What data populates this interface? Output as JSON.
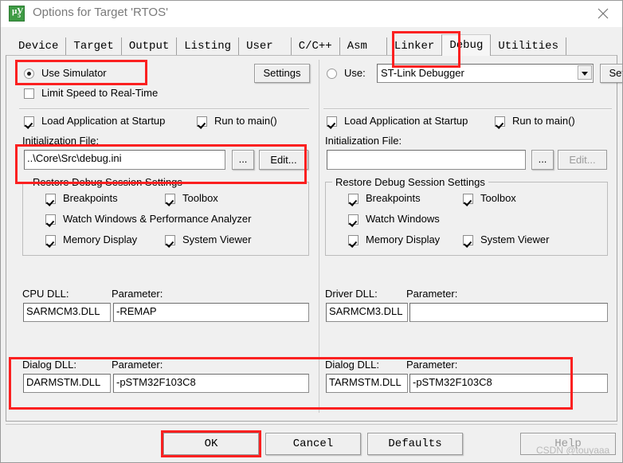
{
  "window": {
    "title": "Options for Target 'RTOS'",
    "icon": "keil-uvision-icon",
    "icon_glyph_top": "µV",
    "icon_glyph_bottom": "5",
    "close_icon": "close-icon"
  },
  "tabs": [
    {
      "label": "Device",
      "active": false
    },
    {
      "label": "Target",
      "active": false
    },
    {
      "label": "Output",
      "active": false
    },
    {
      "label": "Listing",
      "active": false
    },
    {
      "label": "User",
      "active": false
    },
    {
      "label": "C/C++",
      "active": false
    },
    {
      "label": "Asm",
      "active": false
    },
    {
      "label": "Linker",
      "active": false
    },
    {
      "label": "Debug",
      "active": true
    },
    {
      "label": "Utilities",
      "active": false
    }
  ],
  "left": {
    "use_simulator_label": "Use Simulator",
    "use_simulator_checked": true,
    "settings_button": "Settings",
    "limit_speed_label": "Limit Speed to Real-Time",
    "limit_speed_checked": false,
    "load_app_label": "Load Application at Startup",
    "load_app_checked": true,
    "run_to_main_label": "Run to main()",
    "run_to_main_checked": true,
    "init_file_label": "Initialization File:",
    "init_file_value": "..\\Core\\Src\\debug.ini",
    "browse_button": "...",
    "edit_button": "Edit...",
    "restore_group_title": "Restore Debug Session Settings",
    "restore_items": [
      {
        "label": "Breakpoints",
        "checked": true
      },
      {
        "label": "Toolbox",
        "checked": true
      },
      {
        "label": "Watch Windows & Performance Analyzer",
        "checked": true
      },
      {
        "label": "Memory Display",
        "checked": true
      },
      {
        "label": "System Viewer",
        "checked": true
      }
    ],
    "cpu_dll_label": "CPU DLL:",
    "cpu_dll_value": "SARMCM3.DLL",
    "cpu_param_label": "Parameter:",
    "cpu_param_value": "-REMAP",
    "dialog_dll_label": "Dialog DLL:",
    "dialog_dll_value": "DARMSTM.DLL",
    "dialog_param_label": "Parameter:",
    "dialog_param_value": "-pSTM32F103C8"
  },
  "right": {
    "use_label": "Use:",
    "use_checked": false,
    "debugger_selected": "ST-Link Debugger",
    "settings_button": "Settings",
    "load_app_label": "Load Application at Startup",
    "load_app_checked": true,
    "run_to_main_label": "Run to main()",
    "run_to_main_checked": true,
    "init_file_label": "Initialization File:",
    "init_file_value": "",
    "browse_button": "...",
    "edit_button": "Edit...",
    "restore_group_title": "Restore Debug Session Settings",
    "restore_items": [
      {
        "label": "Breakpoints",
        "checked": true
      },
      {
        "label": "Toolbox",
        "checked": true
      },
      {
        "label": "Watch Windows",
        "checked": true
      },
      {
        "label": "Memory Display",
        "checked": true
      },
      {
        "label": "System Viewer",
        "checked": true
      }
    ],
    "driver_dll_label": "Driver DLL:",
    "driver_dll_value": "SARMCM3.DLL",
    "driver_param_label": "Parameter:",
    "driver_param_value": "",
    "dialog_dll_label": "Dialog DLL:",
    "dialog_dll_value": "TARMSTM.DLL",
    "dialog_param_label": "Parameter:",
    "dialog_param_value": "-pSTM32F103C8"
  },
  "footer": {
    "ok": "OK",
    "cancel": "Cancel",
    "defaults": "Defaults",
    "help": "Help"
  },
  "watermark": "CSDN @touyaaa",
  "colors": {
    "annotation": "#fb2020",
    "dialog_bg": "#f0f0f0",
    "title_text": "#7a7a7a",
    "icon_green": "#3f9b45"
  }
}
